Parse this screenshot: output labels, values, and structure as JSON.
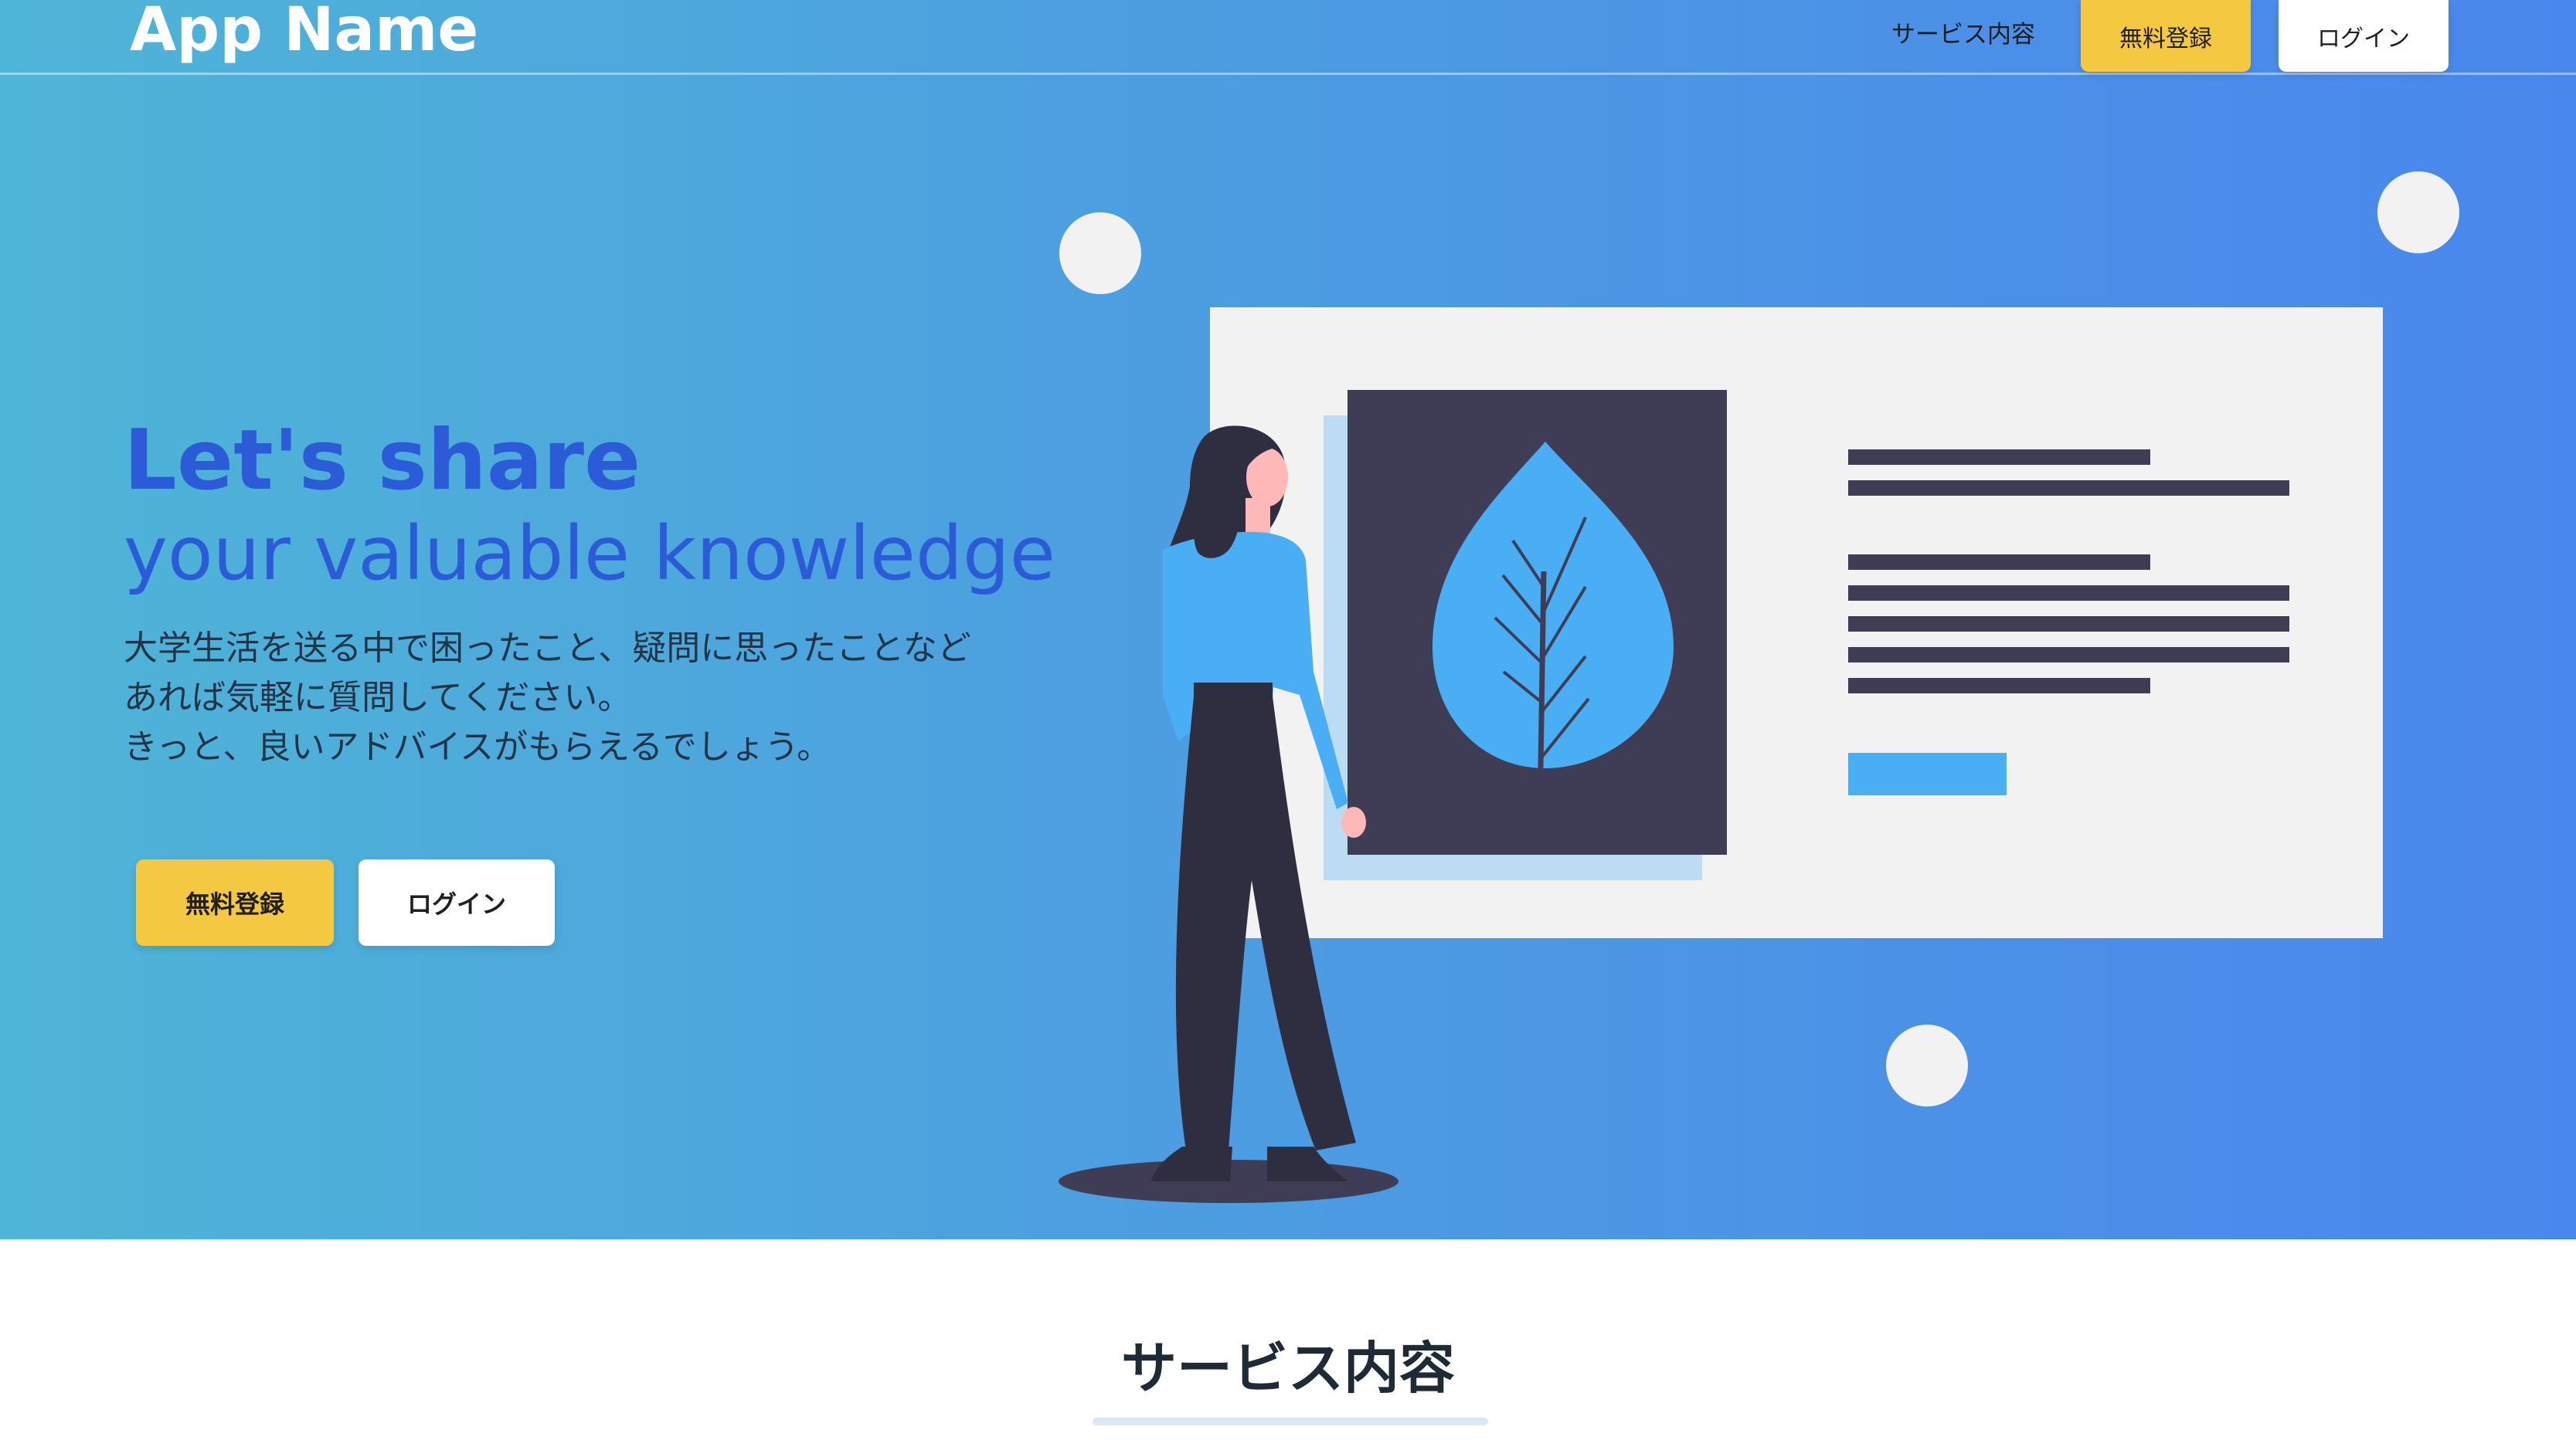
{
  "navbar": {
    "brand": "App Name",
    "links": {
      "service": "サービス内容"
    },
    "register_label": "無料登録",
    "login_label": "ログイン"
  },
  "hero": {
    "headline_line1": "Let's share",
    "headline_line2": "your valuable knowledge",
    "lead_lines": [
      "大学生活を送る中で困ったこと、疑問に思ったことなど",
      "あれば気軽に質問してください。",
      "きっと、良いアドバイスがもらえるでしょう。"
    ],
    "register_label": "無料登録",
    "login_label": "ログイン"
  },
  "section": {
    "title": "サービス内容"
  },
  "colors": {
    "accent_blue": "#2b5bd6",
    "button_yellow": "#f5c842",
    "hero_gradient_start": "#4fb5d7",
    "hero_gradient_end": "#4a87ed",
    "leaf_blue": "#4aaef5",
    "dark_navy": "#3f3d56"
  }
}
